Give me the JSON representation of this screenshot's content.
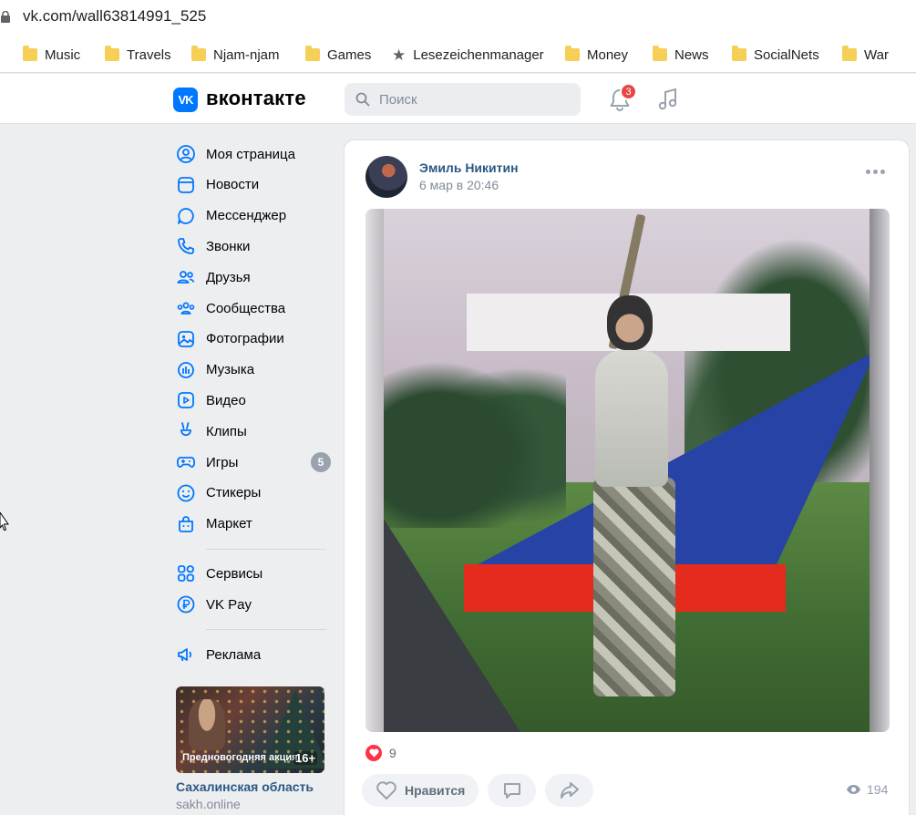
{
  "browser": {
    "url": "vk.com/wall63814991_525",
    "bookmarks": [
      {
        "label": "Music",
        "icon": "folder-icon"
      },
      {
        "label": "Travels",
        "icon": "folder-icon"
      },
      {
        "label": "Njam-njam",
        "icon": "folder-icon"
      },
      {
        "label": "Games",
        "icon": "folder-icon"
      },
      {
        "label": "Lesezeichenmanager",
        "icon": "star-icon"
      },
      {
        "label": "Money",
        "icon": "folder-icon"
      },
      {
        "label": "News",
        "icon": "folder-icon"
      },
      {
        "label": "SocialNets",
        "icon": "folder-icon"
      },
      {
        "label": "War",
        "icon": "folder-icon"
      }
    ]
  },
  "header": {
    "logo_text": "VK",
    "brand": "вконтакте",
    "search_placeholder": "Поиск",
    "notifications_count": "3",
    "accent_color": "#0077ff"
  },
  "sidebar": {
    "items": [
      {
        "label": "Моя страница",
        "icon": "user-circle-icon"
      },
      {
        "label": "Новости",
        "icon": "news-icon"
      },
      {
        "label": "Мессенджер",
        "icon": "message-icon"
      },
      {
        "label": "Звонки",
        "icon": "phone-icon"
      },
      {
        "label": "Друзья",
        "icon": "friends-icon"
      },
      {
        "label": "Сообщества",
        "icon": "communities-icon"
      },
      {
        "label": "Фотографии",
        "icon": "photo-icon"
      },
      {
        "label": "Музыка",
        "icon": "music-icon"
      },
      {
        "label": "Видео",
        "icon": "video-icon"
      },
      {
        "label": "Клипы",
        "icon": "clips-icon"
      },
      {
        "label": "Игры",
        "icon": "games-icon",
        "count": "5"
      },
      {
        "label": "Стикеры",
        "icon": "sticker-icon"
      },
      {
        "label": "Маркет",
        "icon": "market-icon"
      }
    ],
    "secondary": [
      {
        "label": "Сервисы",
        "icon": "services-icon"
      },
      {
        "label": "VK Pay",
        "icon": "vkpay-icon"
      }
    ],
    "tertiary": [
      {
        "label": "Реклама",
        "icon": "ads-icon"
      }
    ],
    "ad": {
      "caption": "Предновогодняя акция",
      "age": "16+",
      "title": "Сахалинская область",
      "subtitle": "sakh.online"
    }
  },
  "post": {
    "author": "Эмиль Никитин",
    "date": "6 мар в 20:46",
    "likes": "9",
    "like_label": "Нравится",
    "views": "194"
  }
}
